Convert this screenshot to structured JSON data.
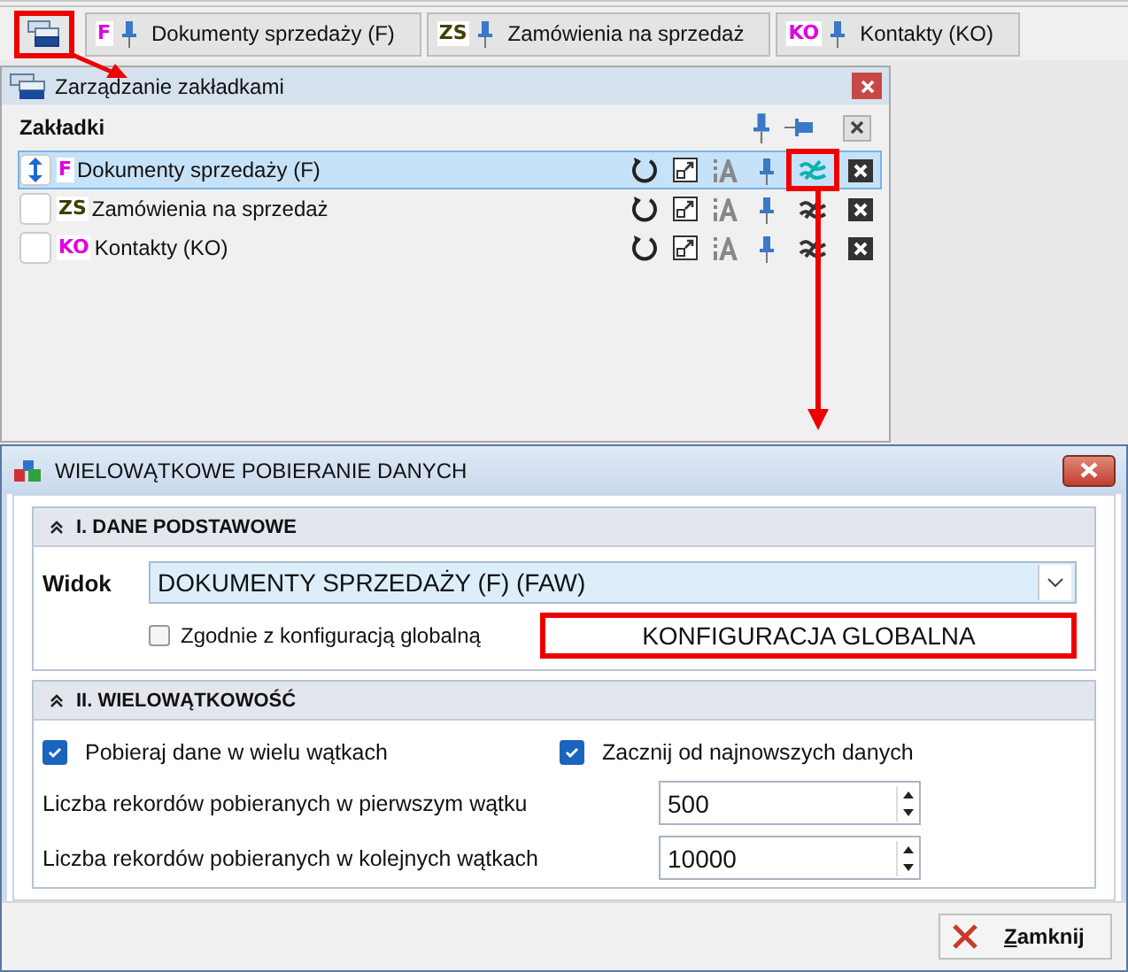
{
  "tabbar": {
    "manager_button": {
      "highlighted": true
    },
    "tabs": [
      {
        "badge": "F",
        "color": "#e000e0",
        "label": "Dokumenty sprzedaży (F)"
      },
      {
        "badge": "ZS",
        "color": "#404000",
        "label": "Zamówienia na sprzedaż"
      },
      {
        "badge": "KO",
        "color": "#e000e0",
        "label": "Kontakty (KO)"
      }
    ]
  },
  "panel": {
    "title": "Zarządzanie zakładkami",
    "heading": "Zakładki",
    "rows": [
      {
        "badge": "F",
        "color": "#e000e0",
        "label": "Dokumenty sprzedaży (F)",
        "selected": true,
        "sync_active": true,
        "highlighted": true
      },
      {
        "badge": "ZS",
        "color": "#404000",
        "label": "Zamówienia na sprzedaż",
        "selected": false,
        "sync_active": false,
        "highlighted": false
      },
      {
        "badge": "KO",
        "color": "#e000e0",
        "label": "Kontakty (KO)",
        "selected": false,
        "sync_active": false,
        "highlighted": false
      }
    ]
  },
  "dialog": {
    "title": "WIELOWĄTKOWE POBIERANIE DANYCH",
    "section_1": {
      "title": "I. DANE PODSTAWOWE",
      "expanded": true,
      "view_label": "Widok",
      "view_value": "DOKUMENTY SPRZEDAŻY (F) (FAW)",
      "global_checkbox": {
        "label": "Zgodnie z konfiguracją globalną",
        "checked": false
      },
      "global_button": {
        "label": "KONFIGURACJA GLOBALNA",
        "highlighted": true
      }
    },
    "section_2": {
      "title": "II. WIELOWĄTKOWOŚĆ",
      "expanded": true,
      "checkboxes": [
        {
          "label": "Pobieraj dane w wielu wątkach",
          "checked": true
        },
        {
          "label": "Zacznij od najnowszych danych",
          "checked": true
        }
      ],
      "spin_fields": [
        {
          "label": "Liczba rekordów pobieranych w pierwszym wątku",
          "value": "500"
        },
        {
          "label": "Liczba rekordów pobieranych w kolejnych wątkach",
          "value": "10000"
        }
      ]
    },
    "close_button": "Zamknij"
  }
}
